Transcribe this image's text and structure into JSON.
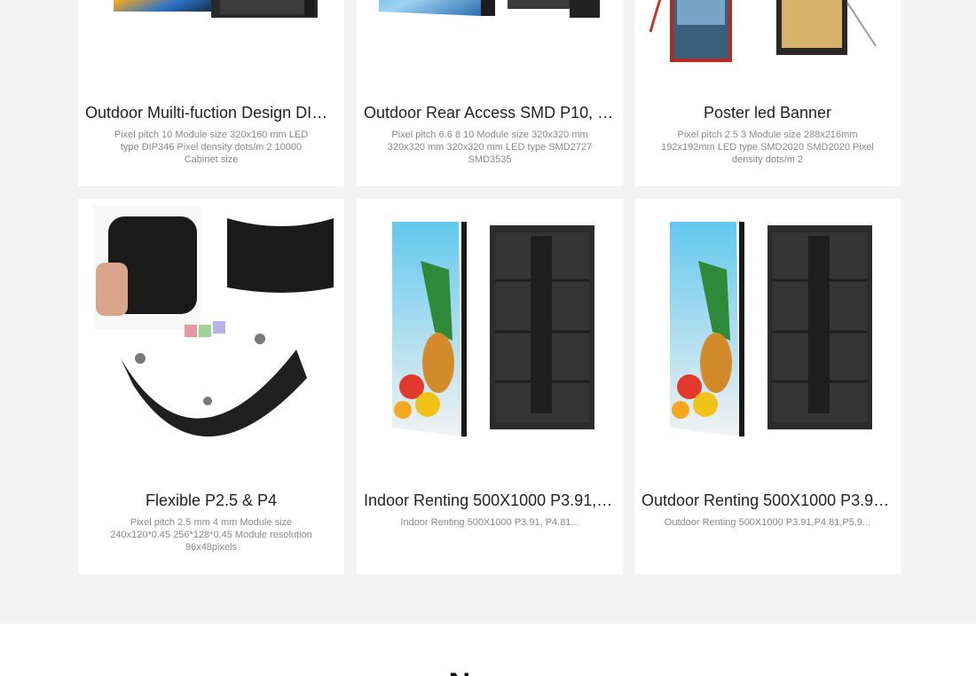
{
  "products": [
    {
      "title": "Outdoor Muilti-fuction Design DIP ...",
      "desc": "Pixel pitch 10 Module size 320x160 mm LED type DIP346 Pixel density dots/m 2 10000 Cabinet size",
      "image": "outdoor-led-cabinet-image"
    },
    {
      "title": "Outdoor Rear Access SMD P10, P...",
      "desc": "Pixel pitch 6.6 8 10 Module size 320x320 mm 320x320 mm 320x320 mm LED type SMD2727 SMD3535",
      "image": "rear-access-led-cabinet-image"
    },
    {
      "title": "Poster led Banner",
      "desc": "Pixel pitch 2.5 3 Module size 288x216mm 192x192mm LED type SMD2020 SMD2020 Pixel density dots/m 2",
      "image": "poster-led-banner-image"
    },
    {
      "title": "Flexible P2.5 & P4",
      "desc": "Pixel pitch 2.5 mm 4 mm Module size 240x120*0.45 256*128*0.45 Module resolution 96x48pixels",
      "image": "flexible-led-module-image"
    },
    {
      "title": "Indoor Renting 500X1000 P3.91, P...",
      "desc": "Indoor Renting 500X1000 P3.91, P4.81...",
      "image": "indoor-rental-cabinet-image"
    },
    {
      "title": "Outdoor Renting 500X1000 P3.91,...",
      "desc": "Outdoor Renting 500X1000 P3.91,P4.81,P5.9...",
      "image": "outdoor-rental-cabinet-image"
    }
  ],
  "news": {
    "title": "News"
  },
  "colors": {
    "page_bg": "#f3f3f3",
    "card_bg": "#ffffff",
    "title_text": "#222222",
    "desc_text": "#888888"
  }
}
